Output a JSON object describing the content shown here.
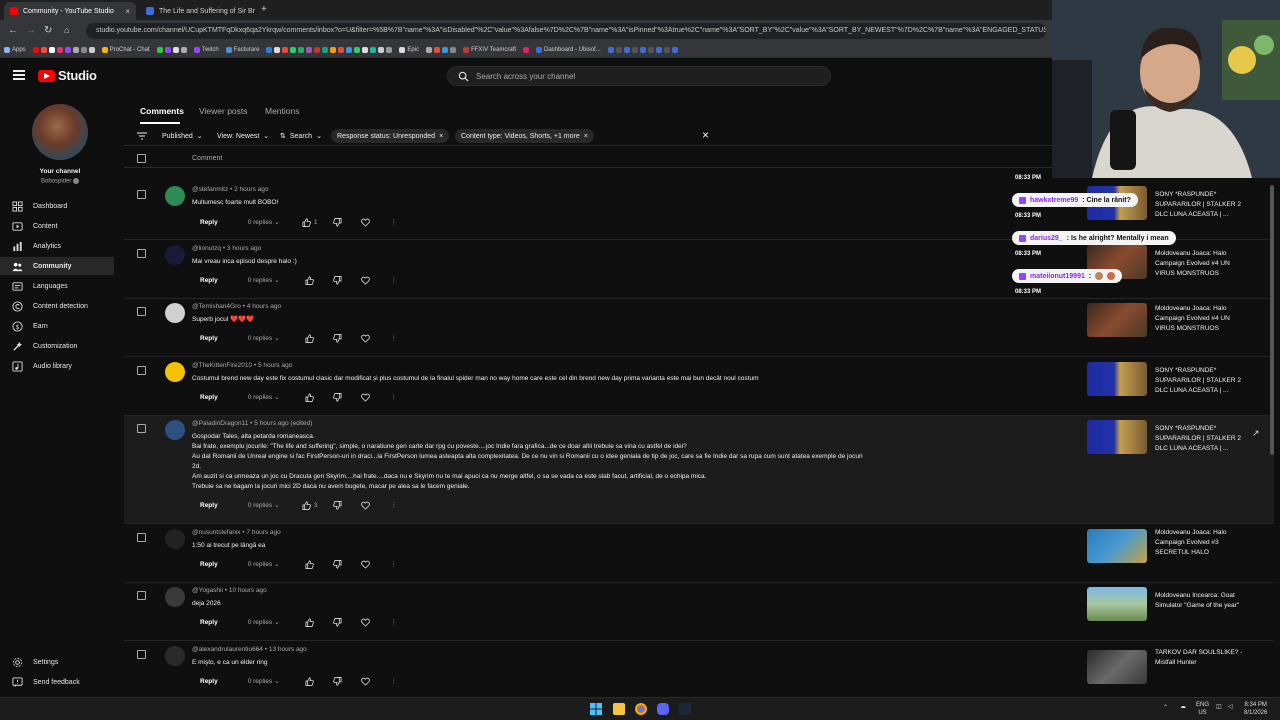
{
  "browser": {
    "tabs": [
      {
        "title": "Community - YouTube Studio",
        "close": "×"
      },
      {
        "title": "The Life and Suffering of Sir Br",
        "close": "×"
      }
    ],
    "new_tab": "+",
    "url": "studio.youtube.com/channel/UCupKTMTFqDkxq6qa2Ykrqw/comments/inbox?o=U&filter=%5B%7B\"name\"%3A\"isDisabled\"%2C\"value\"%3Afalse%7D%2C%7B\"name\"%3A\"isPinned\"%3Atrue%2C\"name\"%3A\"SORT_BY\"%2C\"value\"%3A\"SORT_BY_NEWEST\"%7D%2C%7B\"name\"%3A\"ENGAGED_STATUS\"%2C\"value\"%3A%5B\"COMMENT_CATEGORY_NOT_E...",
    "bookmarks": [
      "Apps",
      "ProChat - Chat",
      "Twitch",
      "Facturare",
      "Epic",
      "FFXIV Teamcraft",
      "Dashboard - Ubisof..."
    ]
  },
  "studio": {
    "logo_text": "Studio",
    "search_placeholder": "Search across your channel"
  },
  "sidebar": {
    "your_channel": "Your channel",
    "channel_name": "Bobospider",
    "items": [
      {
        "label": "Dashboard",
        "icon": "dashboard-icon"
      },
      {
        "label": "Content",
        "icon": "content-icon"
      },
      {
        "label": "Analytics",
        "icon": "analytics-icon"
      },
      {
        "label": "Community",
        "icon": "community-icon",
        "active": true
      },
      {
        "label": "Languages",
        "icon": "languages-icon"
      },
      {
        "label": "Content detection",
        "icon": "copyright-icon"
      },
      {
        "label": "Earn",
        "icon": "earn-icon"
      },
      {
        "label": "Customization",
        "icon": "customization-icon"
      },
      {
        "label": "Audio library",
        "icon": "audio-library-icon"
      }
    ],
    "settings": "Settings",
    "send_feedback": "Send feedback"
  },
  "tabs": {
    "comments": "Comments",
    "viewer_posts": "Viewer posts",
    "mentions": "Mentions"
  },
  "filters": {
    "published": "Published",
    "view": "View: Newest",
    "search": "Search",
    "response_status": "Response status: Unresponded",
    "content_type": "Content type: Videos, Shorts, +1 more"
  },
  "column_header": "Comment",
  "reply_label": "Reply",
  "replies_label": "0 replies",
  "comments": [
    {
      "author": "@stefanmitz",
      "time": "2 hours ago",
      "text": [
        "Multumesc foarte mult BOBO!"
      ],
      "likes": "1",
      "video": "SONY *RASPUNDE* SUPARARILOR | STALKER 2 DLC LUNA ACEASTA | ..."
    },
    {
      "author": "@lionutzq",
      "time": "3 hours ago",
      "text": [
        "Mai vreau inca episod despre halo :)"
      ],
      "likes": "",
      "video": "Moldoveanu Joaca: Halo Campaign Evolved #4 UN VIRUS MONSTRUOS"
    },
    {
      "author": "@Temishan4Gro",
      "time": "4 hours ago",
      "text": [
        "Superb jocul ❤️❤️❤️"
      ],
      "likes": "",
      "video": "Moldoveanu Joaca: Halo Campaign Evolved #4 UN VIRUS MONSTRUOS"
    },
    {
      "author": "@TheKittenFire2010",
      "time": "5 hours ago",
      "text": [
        "Costumul brend new day este fix costumul clasic dar modificat și plus costumul de la finalul spider man no way home care este cel din brend new day prima varianta este mai bun decât noul costum"
      ],
      "likes": "",
      "video": "SONY *RASPUNDE* SUPARARILOR | STALKER 2 DLC LUNA ACEASTA | ..."
    },
    {
      "author": "@PaladinDragon11",
      "time": "5 hours ago (edited)",
      "text": [
        "Gospodar Tales, alta petarda romaneasca.",
        "Bai frate, exemplu jocurile: \"The life and suffering\", simple, o naratiune gen carte dar rpg cu poveste....joc Indie fara grafica...de ce doar altii trebuie sa vina cu astfel de idei?",
        "Au dat Romanii de Unreal engine si fac FirstPerson-uri in draci...la FirstPerson lumea asteapta alta complexitatea. De ce nu vin si Romanii cu o idee geniala de tip de joc, care sa fie Indie dar sa rupa cum sunt atatea exemple de jocuri 2d.",
        "Am auzit si ca urmeaza un joc cu Dracula gen Skyrim....hai frate....daca nu e Skyrim nu te mai apuci ca nu merge altfel, o sa se vada ca este slab facut, artificial, de o echipa mica.",
        "Trebuie sa ne bagam la jocuri mici 2D daca nu avem bugete, macar pe alea sa le facem geniale."
      ],
      "likes": "3",
      "video": "SONY *RASPUNDE* SUPARARILOR | STALKER 2 DLC LUNA ACEASTA | ..."
    },
    {
      "author": "@nusuntstefanix",
      "time": "7 hours ago",
      "text": [
        "1:50 ai trecut pe lângă ea"
      ],
      "likes": "",
      "video": "Moldoveanu Joaca: Halo Campaign Evolved #3 SECRETUL HALO"
    },
    {
      "author": "@Yogashii",
      "time": "10 hours ago",
      "text": [
        "deja 2026"
      ],
      "likes": "",
      "video": "Moldoveanu Incearca: Goat Simulator \"Game of the year\""
    },
    {
      "author": "@alexandrulaurentiu664",
      "time": "13 hours ago",
      "text": [
        "E mişto, e ca un elder ring"
      ],
      "likes": "",
      "video": "TARKOV DAR SOULSLIKE? - Mistfall Hunter"
    }
  ],
  "overlay_chat": [
    {
      "time": "08:33 PM",
      "user": "hawkxtreme99",
      "message": ": Cine la rănit?"
    },
    {
      "time": "08:33 PM",
      "user": "darius29_",
      "message": ": Is he alright? Mentally i mean"
    },
    {
      "time": "08:33 PM",
      "user": "mateiionut19991",
      "message": ":"
    },
    {
      "time": "08:33 PM",
      "user": "",
      "message": ""
    }
  ],
  "taskbar": {
    "lang": "ENG",
    "region": "US",
    "time": "8:34 PM",
    "date": "8/1/2026"
  },
  "colors": {
    "accent_red": "#ff0000",
    "chat_user": "#8a2be2",
    "bg": "#0f0f0f"
  }
}
